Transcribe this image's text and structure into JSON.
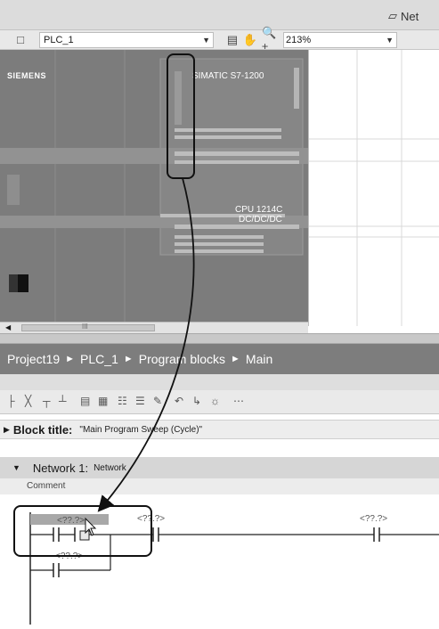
{
  "header": {
    "network_tab": "Net"
  },
  "device_view": {
    "device_select": "PLC_1",
    "zoom": "213%",
    "brand": "SIEMENS",
    "model": "SIMATIC S7-1200",
    "cpu_label_1": "CPU 1214C",
    "cpu_label_2": "DC/DC/DC",
    "scroll_label": "III"
  },
  "breadcrumb": [
    "Project19",
    "PLC_1",
    "Program blocks",
    "Main"
  ],
  "block": {
    "title_label": "Block title:",
    "title_value": "\"Main Program Sweep (Cycle)\""
  },
  "network": {
    "title": "Network 1:",
    "name": "Network",
    "comment_label": "Comment"
  },
  "ladder": {
    "contact_1_address": "<??.?>",
    "contact_2_address": "<??.?>",
    "coil_address": "<??.?>",
    "branch_contact_address": "<??.?>"
  },
  "colors": {
    "breadcrumb_bg": "#7d7d7d",
    "device_body": "#7c7c7c",
    "highlight": "#1a1a1a"
  }
}
